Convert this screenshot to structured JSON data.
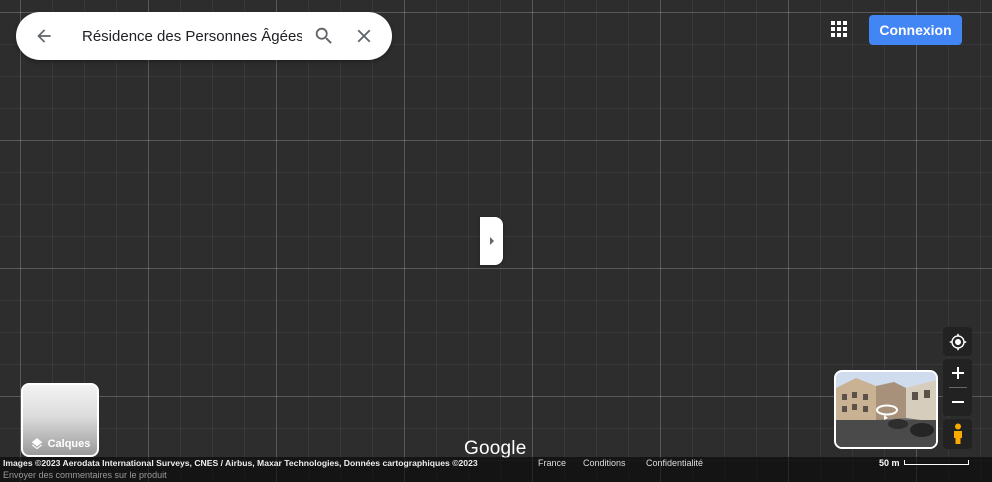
{
  "search": {
    "value": "Résidence des Personnes Âgées",
    "back_icon": "arrow-left-icon",
    "search_icon": "magnifier-icon",
    "clear_icon": "close-icon"
  },
  "header": {
    "apps_icon": "apps-grid-icon",
    "login_label": "Connexion",
    "login_color": "#4285f4"
  },
  "side_panel_toggle": {
    "icon": "chevron-right-icon"
  },
  "layers": {
    "label": "Calques",
    "icon": "layers-icon"
  },
  "logo": "Google",
  "footer": {
    "attribution": "Images ©2023 Aerodata International Surveys, CNES / Airbus, Maxar Technologies, Données cartographiques ©2023",
    "country": "France",
    "terms": "Conditions",
    "privacy": "Confidentialité",
    "feedback": "Envoyer des commentaires sur le produit",
    "scale": "50 m"
  },
  "controls": {
    "locate_icon": "my-location-icon",
    "zoom_in_icon": "plus-icon",
    "zoom_out_icon": "minus-icon",
    "pegman_icon": "pegman-icon"
  },
  "street_view": {
    "icon": "rotate-360-icon"
  }
}
